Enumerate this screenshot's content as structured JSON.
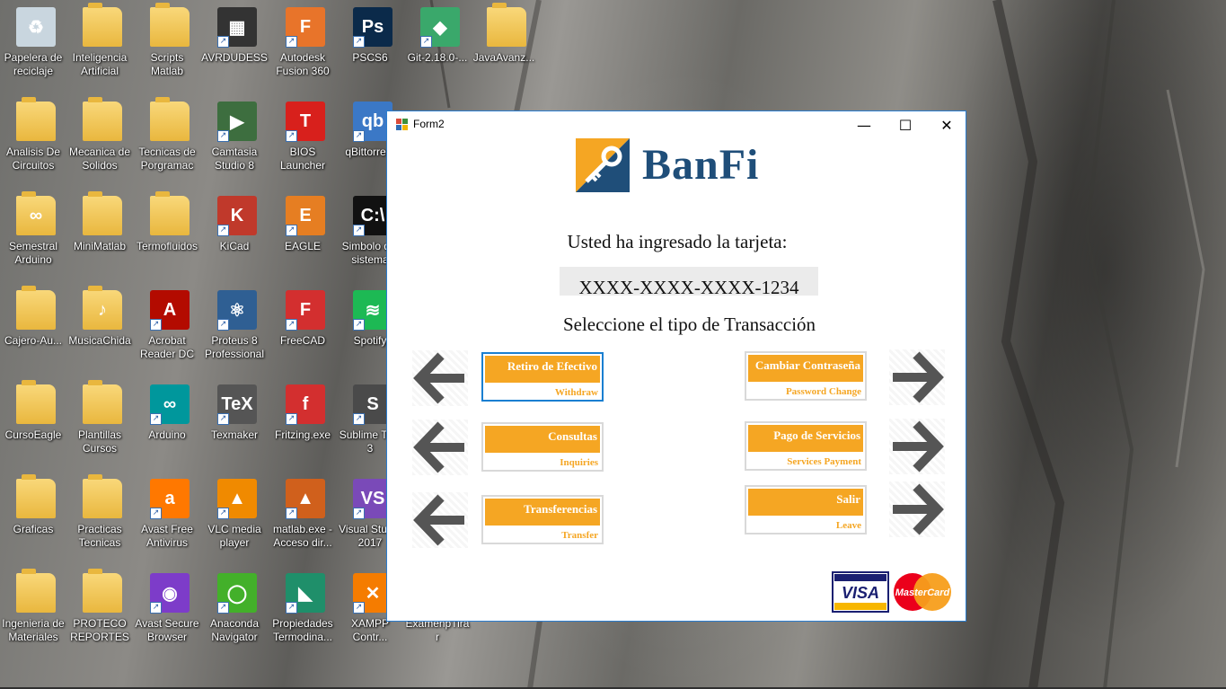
{
  "desktop": {
    "icons": [
      {
        "label": "Papelera de reciclaje",
        "color": "#c9d6df",
        "glyph": "♻",
        "kind": "app",
        "col": 0,
        "row": 0
      },
      {
        "label": "Inteligencia Artificial",
        "color": "#f3c552",
        "glyph": "",
        "kind": "folder",
        "col": 1,
        "row": 0
      },
      {
        "label": "Scripts Matlab",
        "color": "#f3c552",
        "glyph": "",
        "kind": "folder",
        "col": 2,
        "row": 0
      },
      {
        "label": "AVRDUDESS",
        "color": "#333333",
        "glyph": "▦",
        "kind": "app",
        "col": 3,
        "row": 0
      },
      {
        "label": "Autodesk Fusion 360",
        "color": "#e8742a",
        "glyph": "F",
        "kind": "app",
        "col": 4,
        "row": 0
      },
      {
        "label": "PSCS6",
        "color": "#0b2a4a",
        "glyph": "Ps",
        "kind": "app",
        "col": 5,
        "row": 0
      },
      {
        "label": "Git-2.18.0-...",
        "color": "#3aa86b",
        "glyph": "◆",
        "kind": "app",
        "col": 6,
        "row": 0
      },
      {
        "label": "JavaAvanz...",
        "color": "#f3c552",
        "glyph": "",
        "kind": "folder",
        "col": 7,
        "row": 0
      },
      {
        "label": "Analisis De Circuitos",
        "color": "#f3c552",
        "glyph": "",
        "kind": "folder",
        "col": 0,
        "row": 1
      },
      {
        "label": "Mecanica de Solidos",
        "color": "#f3c552",
        "glyph": "",
        "kind": "folder",
        "col": 1,
        "row": 1
      },
      {
        "label": "Tecnicas de Porgramac",
        "color": "#f3c552",
        "glyph": "",
        "kind": "folder",
        "col": 2,
        "row": 1
      },
      {
        "label": "Camtasia Studio 8",
        "color": "#3d6e3f",
        "glyph": "▶",
        "kind": "app",
        "col": 3,
        "row": 1
      },
      {
        "label": "BIOS Launcher",
        "color": "#d8201c",
        "glyph": "T",
        "kind": "app",
        "col": 4,
        "row": 1
      },
      {
        "label": "qBittorre...",
        "color": "#3b78c6",
        "glyph": "qb",
        "kind": "app",
        "col": 5,
        "row": 1
      },
      {
        "label": "Semestral Arduino",
        "color": "#f3c552",
        "glyph": "∞",
        "kind": "folder",
        "col": 0,
        "row": 2
      },
      {
        "label": "MiniMatlab",
        "color": "#f3c552",
        "glyph": "",
        "kind": "folder",
        "col": 1,
        "row": 2
      },
      {
        "label": "Termofluidos",
        "color": "#f3c552",
        "glyph": "",
        "kind": "folder",
        "col": 2,
        "row": 2
      },
      {
        "label": "KiCad",
        "color": "#c0392b",
        "glyph": "K",
        "kind": "app",
        "col": 3,
        "row": 2
      },
      {
        "label": "EAGLE",
        "color": "#e67e22",
        "glyph": "E",
        "kind": "app",
        "col": 4,
        "row": 2
      },
      {
        "label": "Simbolo del sistema",
        "color": "#111111",
        "glyph": "C:\\",
        "kind": "app",
        "col": 5,
        "row": 2
      },
      {
        "label": "Cajero-Au...",
        "color": "#f3c552",
        "glyph": "",
        "kind": "folder",
        "col": 0,
        "row": 3
      },
      {
        "label": "MusicaChida",
        "color": "#f3c552",
        "glyph": "♪",
        "kind": "folder",
        "col": 1,
        "row": 3
      },
      {
        "label": "Acrobat Reader DC",
        "color": "#b30b00",
        "glyph": "A",
        "kind": "app",
        "col": 2,
        "row": 3
      },
      {
        "label": "Proteus 8 Professional",
        "color": "#2f5f93",
        "glyph": "⚛",
        "kind": "app",
        "col": 3,
        "row": 3
      },
      {
        "label": "FreeCAD",
        "color": "#d32f2f",
        "glyph": "F",
        "kind": "app",
        "col": 4,
        "row": 3
      },
      {
        "label": "Spotify",
        "color": "#1db954",
        "glyph": "≋",
        "kind": "app",
        "col": 5,
        "row": 3
      },
      {
        "label": "CursoEagle",
        "color": "#f3c552",
        "glyph": "",
        "kind": "folder",
        "col": 0,
        "row": 4
      },
      {
        "label": "Plantillas Cursos",
        "color": "#f3c552",
        "glyph": "",
        "kind": "folder",
        "col": 1,
        "row": 4
      },
      {
        "label": "Arduino",
        "color": "#00979c",
        "glyph": "∞",
        "kind": "app",
        "col": 2,
        "row": 4
      },
      {
        "label": "Texmaker",
        "color": "#555555",
        "glyph": "TeX",
        "kind": "app",
        "col": 3,
        "row": 4
      },
      {
        "label": "Fritzing.exe",
        "color": "#d32f2f",
        "glyph": "f",
        "kind": "app",
        "col": 4,
        "row": 4
      },
      {
        "label": "Sublime Text 3",
        "color": "#4a4a4a",
        "glyph": "S",
        "kind": "app",
        "col": 5,
        "row": 4
      },
      {
        "label": "Graficas",
        "color": "#f3c552",
        "glyph": "",
        "kind": "folder",
        "col": 0,
        "row": 5
      },
      {
        "label": "Practicas Tecnicas",
        "color": "#f3c552",
        "glyph": "",
        "kind": "folder",
        "col": 1,
        "row": 5
      },
      {
        "label": "Avast Free Antivirus",
        "color": "#ff7800",
        "glyph": "a",
        "kind": "app",
        "col": 2,
        "row": 5
      },
      {
        "label": "VLC media player",
        "color": "#f08a00",
        "glyph": "▲",
        "kind": "app",
        "col": 3,
        "row": 5
      },
      {
        "label": "matlab.exe - Acceso dir...",
        "color": "#d0601c",
        "glyph": "▲",
        "kind": "app",
        "col": 4,
        "row": 5
      },
      {
        "label": "Visual Studio 2017",
        "color": "#7a4ab8",
        "glyph": "VS",
        "kind": "app",
        "col": 5,
        "row": 5
      },
      {
        "label": "Ingenieria de Materiales",
        "color": "#f3c552",
        "glyph": "",
        "kind": "folder",
        "col": 0,
        "row": 6
      },
      {
        "label": "PROTECO REPORTES",
        "color": "#f3c552",
        "glyph": "",
        "kind": "folder",
        "col": 1,
        "row": 6
      },
      {
        "label": "Avast Secure Browser",
        "color": "#7d3cc9",
        "glyph": "◉",
        "kind": "app",
        "col": 2,
        "row": 6
      },
      {
        "label": "Anaconda Navigator",
        "color": "#43b02a",
        "glyph": "◯",
        "kind": "app",
        "col": 3,
        "row": 6
      },
      {
        "label": "Propiedades Termodina...",
        "color": "#1f8f6a",
        "glyph": "◣",
        "kind": "app",
        "col": 4,
        "row": 6
      },
      {
        "label": "XAMPP Contr...",
        "color": "#f57c00",
        "glyph": "✕",
        "kind": "app",
        "col": 5,
        "row": 6
      },
      {
        "label": "ExamenpTirar",
        "color": "#f3c552",
        "glyph": "",
        "kind": "folder",
        "col": 6,
        "row": 6
      }
    ]
  },
  "window": {
    "title": "Form2",
    "controls": {
      "minimize": "—",
      "maximize": "☐",
      "close": "✕"
    }
  },
  "form": {
    "brand": "BanFi",
    "prompt": "Usted ha ingresado la tarjeta:",
    "card_number": "XXXX-XXXX-XXXX-1234",
    "select_prompt": "Seleccione el tipo de Transacción",
    "options": [
      {
        "title": "Retiro de Efectivo",
        "subtitle": "Withdraw",
        "side": "left",
        "active": true
      },
      {
        "title": "Consultas",
        "subtitle": "Inquiries",
        "side": "left",
        "active": false
      },
      {
        "title": "Transferencias",
        "subtitle": "Transfer",
        "side": "left",
        "active": false
      },
      {
        "title": "Cambiar Contraseña",
        "subtitle": "Password Change",
        "side": "right",
        "active": false
      },
      {
        "title": "Pago de Servicios",
        "subtitle": "Services Payment",
        "side": "right",
        "active": false
      },
      {
        "title": "Salir",
        "subtitle": "Leave",
        "side": "right",
        "active": false
      }
    ],
    "card_logos": {
      "visa": "VISA",
      "mastercard": "MasterCard"
    },
    "colors": {
      "accent": "#f5a623",
      "brand": "#1f4e79",
      "focus": "#1a7fd1"
    }
  }
}
